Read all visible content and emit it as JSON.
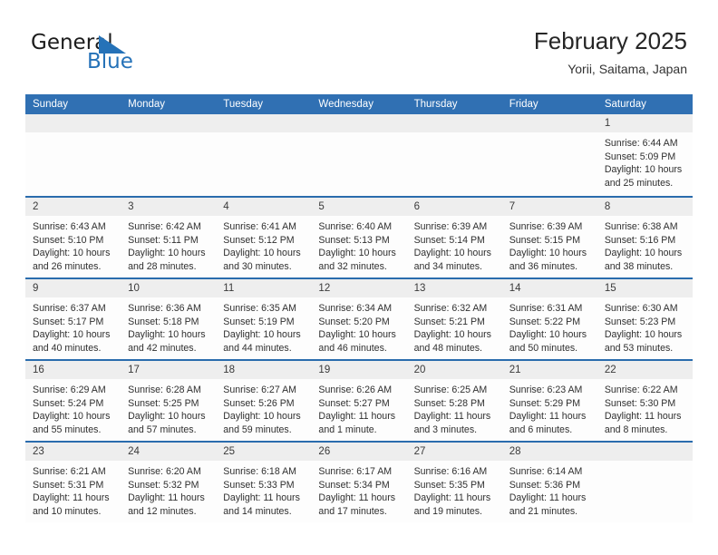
{
  "brand": {
    "name_part1": "General",
    "name_part2": "Blue",
    "flag_icon": "blue-triangle-flag-icon",
    "accent_color": "#2572b8"
  },
  "header": {
    "title": "February 2025",
    "subtitle": "Yorii, Saitama, Japan"
  },
  "calendar": {
    "header_bg": "#3070b3",
    "row_divider": "#2a6cad",
    "daynum_band_bg": "#eeeeee",
    "weekdays": [
      "Sunday",
      "Monday",
      "Tuesday",
      "Wednesday",
      "Thursday",
      "Friday",
      "Saturday"
    ],
    "weeks": [
      [
        {
          "day": "",
          "empty": true
        },
        {
          "day": "",
          "empty": true
        },
        {
          "day": "",
          "empty": true
        },
        {
          "day": "",
          "empty": true
        },
        {
          "day": "",
          "empty": true
        },
        {
          "day": "",
          "empty": true
        },
        {
          "day": "1",
          "sunrise": "Sunrise: 6:44 AM",
          "sunset": "Sunset: 5:09 PM",
          "daylight": "Daylight: 10 hours and 25 minutes."
        }
      ],
      [
        {
          "day": "2",
          "sunrise": "Sunrise: 6:43 AM",
          "sunset": "Sunset: 5:10 PM",
          "daylight": "Daylight: 10 hours and 26 minutes."
        },
        {
          "day": "3",
          "sunrise": "Sunrise: 6:42 AM",
          "sunset": "Sunset: 5:11 PM",
          "daylight": "Daylight: 10 hours and 28 minutes."
        },
        {
          "day": "4",
          "sunrise": "Sunrise: 6:41 AM",
          "sunset": "Sunset: 5:12 PM",
          "daylight": "Daylight: 10 hours and 30 minutes."
        },
        {
          "day": "5",
          "sunrise": "Sunrise: 6:40 AM",
          "sunset": "Sunset: 5:13 PM",
          "daylight": "Daylight: 10 hours and 32 minutes."
        },
        {
          "day": "6",
          "sunrise": "Sunrise: 6:39 AM",
          "sunset": "Sunset: 5:14 PM",
          "daylight": "Daylight: 10 hours and 34 minutes."
        },
        {
          "day": "7",
          "sunrise": "Sunrise: 6:39 AM",
          "sunset": "Sunset: 5:15 PM",
          "daylight": "Daylight: 10 hours and 36 minutes."
        },
        {
          "day": "8",
          "sunrise": "Sunrise: 6:38 AM",
          "sunset": "Sunset: 5:16 PM",
          "daylight": "Daylight: 10 hours and 38 minutes."
        }
      ],
      [
        {
          "day": "9",
          "sunrise": "Sunrise: 6:37 AM",
          "sunset": "Sunset: 5:17 PM",
          "daylight": "Daylight: 10 hours and 40 minutes."
        },
        {
          "day": "10",
          "sunrise": "Sunrise: 6:36 AM",
          "sunset": "Sunset: 5:18 PM",
          "daylight": "Daylight: 10 hours and 42 minutes."
        },
        {
          "day": "11",
          "sunrise": "Sunrise: 6:35 AM",
          "sunset": "Sunset: 5:19 PM",
          "daylight": "Daylight: 10 hours and 44 minutes."
        },
        {
          "day": "12",
          "sunrise": "Sunrise: 6:34 AM",
          "sunset": "Sunset: 5:20 PM",
          "daylight": "Daylight: 10 hours and 46 minutes."
        },
        {
          "day": "13",
          "sunrise": "Sunrise: 6:32 AM",
          "sunset": "Sunset: 5:21 PM",
          "daylight": "Daylight: 10 hours and 48 minutes."
        },
        {
          "day": "14",
          "sunrise": "Sunrise: 6:31 AM",
          "sunset": "Sunset: 5:22 PM",
          "daylight": "Daylight: 10 hours and 50 minutes."
        },
        {
          "day": "15",
          "sunrise": "Sunrise: 6:30 AM",
          "sunset": "Sunset: 5:23 PM",
          "daylight": "Daylight: 10 hours and 53 minutes."
        }
      ],
      [
        {
          "day": "16",
          "sunrise": "Sunrise: 6:29 AM",
          "sunset": "Sunset: 5:24 PM",
          "daylight": "Daylight: 10 hours and 55 minutes."
        },
        {
          "day": "17",
          "sunrise": "Sunrise: 6:28 AM",
          "sunset": "Sunset: 5:25 PM",
          "daylight": "Daylight: 10 hours and 57 minutes."
        },
        {
          "day": "18",
          "sunrise": "Sunrise: 6:27 AM",
          "sunset": "Sunset: 5:26 PM",
          "daylight": "Daylight: 10 hours and 59 minutes."
        },
        {
          "day": "19",
          "sunrise": "Sunrise: 6:26 AM",
          "sunset": "Sunset: 5:27 PM",
          "daylight": "Daylight: 11 hours and 1 minute."
        },
        {
          "day": "20",
          "sunrise": "Sunrise: 6:25 AM",
          "sunset": "Sunset: 5:28 PM",
          "daylight": "Daylight: 11 hours and 3 minutes."
        },
        {
          "day": "21",
          "sunrise": "Sunrise: 6:23 AM",
          "sunset": "Sunset: 5:29 PM",
          "daylight": "Daylight: 11 hours and 6 minutes."
        },
        {
          "day": "22",
          "sunrise": "Sunrise: 6:22 AM",
          "sunset": "Sunset: 5:30 PM",
          "daylight": "Daylight: 11 hours and 8 minutes."
        }
      ],
      [
        {
          "day": "23",
          "sunrise": "Sunrise: 6:21 AM",
          "sunset": "Sunset: 5:31 PM",
          "daylight": "Daylight: 11 hours and 10 minutes."
        },
        {
          "day": "24",
          "sunrise": "Sunrise: 6:20 AM",
          "sunset": "Sunset: 5:32 PM",
          "daylight": "Daylight: 11 hours and 12 minutes."
        },
        {
          "day": "25",
          "sunrise": "Sunrise: 6:18 AM",
          "sunset": "Sunset: 5:33 PM",
          "daylight": "Daylight: 11 hours and 14 minutes."
        },
        {
          "day": "26",
          "sunrise": "Sunrise: 6:17 AM",
          "sunset": "Sunset: 5:34 PM",
          "daylight": "Daylight: 11 hours and 17 minutes."
        },
        {
          "day": "27",
          "sunrise": "Sunrise: 6:16 AM",
          "sunset": "Sunset: 5:35 PM",
          "daylight": "Daylight: 11 hours and 19 minutes."
        },
        {
          "day": "28",
          "sunrise": "Sunrise: 6:14 AM",
          "sunset": "Sunset: 5:36 PM",
          "daylight": "Daylight: 11 hours and 21 minutes."
        },
        {
          "day": "",
          "empty": true
        }
      ]
    ]
  }
}
